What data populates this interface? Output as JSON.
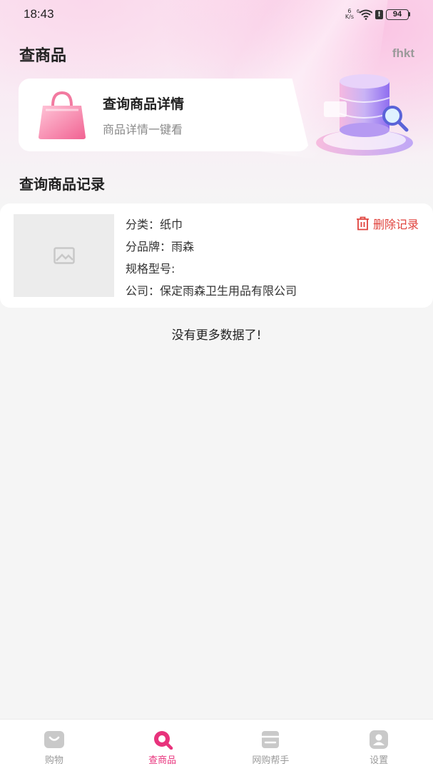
{
  "status_bar": {
    "time": "18:43",
    "net_speed_value": "6",
    "net_speed_unit": "K/s",
    "wifi_badge": "6",
    "battery": "94"
  },
  "header": {
    "title": "查商品",
    "corner_tag": "fhkt"
  },
  "search_card": {
    "title": "查询商品详情",
    "subtitle": "商品详情一键看",
    "icon": "shopping-bag-icon"
  },
  "records": {
    "section_title": "查询商品记录",
    "items": [
      {
        "category": "分类：纸巾",
        "brand": "分品牌：雨森",
        "model": "规格型号:",
        "company": "公司：保定雨森卫生用品有限公司",
        "delete_label": "删除记录"
      }
    ],
    "end_text": "没有更多数据了!"
  },
  "tab_bar": {
    "tabs": [
      {
        "label": "购物",
        "icon": "shop-icon",
        "active": false
      },
      {
        "label": "查商品",
        "icon": "search-product-icon",
        "active": true
      },
      {
        "label": "网购帮手",
        "icon": "helper-icon",
        "active": false
      },
      {
        "label": "设置",
        "icon": "user-settings-icon",
        "active": false
      }
    ]
  },
  "colors": {
    "accent": "#e8337c",
    "delete": "#e0423c",
    "inactive_tab": "#9a9a9a"
  }
}
